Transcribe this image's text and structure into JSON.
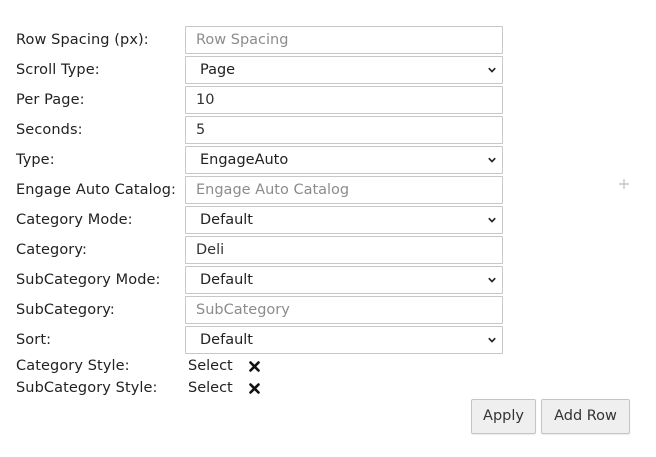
{
  "form": {
    "fields": [
      {
        "label": "Row Spacing (px):",
        "type": "input",
        "value": "",
        "placeholder": "Row Spacing"
      },
      {
        "label": "Scroll Type:",
        "type": "select",
        "value": "Page"
      },
      {
        "label": "Per Page:",
        "type": "input",
        "value": "10",
        "placeholder": ""
      },
      {
        "label": "Seconds:",
        "type": "input",
        "value": "5",
        "placeholder": ""
      },
      {
        "label": "Type:",
        "type": "select",
        "value": "EngageAuto"
      },
      {
        "label": "Engage Auto Catalog:",
        "type": "input",
        "value": "",
        "placeholder": "Engage Auto Catalog"
      },
      {
        "label": "Category Mode:",
        "type": "select",
        "value": "Default"
      },
      {
        "label": "Category:",
        "type": "input",
        "value": "Deli",
        "placeholder": ""
      },
      {
        "label": "SubCategory Mode:",
        "type": "select",
        "value": "Default"
      },
      {
        "label": "SubCategory:",
        "type": "input",
        "value": "",
        "placeholder": "SubCategory"
      },
      {
        "label": "Sort:",
        "type": "select",
        "value": "Default"
      }
    ],
    "styles": [
      {
        "label": "Category Style:",
        "select_label": "Select"
      },
      {
        "label": "SubCategory Style:",
        "select_label": "Select"
      }
    ]
  },
  "actions": {
    "apply_label": "Apply",
    "add_row_label": "Add Row"
  },
  "icons": {
    "remove": "close-x-icon",
    "dropdown": "chevron-down-icon",
    "add": "plus-icon"
  }
}
